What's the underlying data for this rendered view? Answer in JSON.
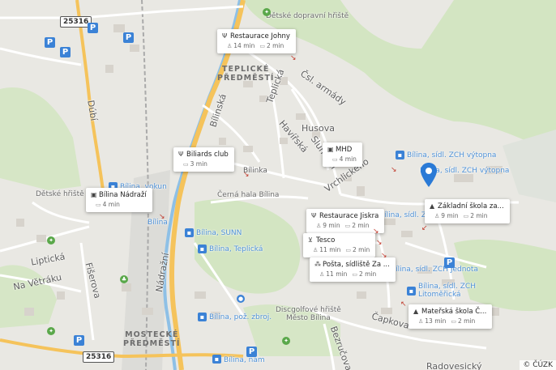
{
  "map": {
    "copyright": "© ČÚZK",
    "road_numbers": [
      "25316",
      "25316"
    ],
    "districts": [
      "TEPLICKÉ\nPŘEDMĚSTÍ",
      "MOSTECKÉ\nPŘEDMĚSTÍ"
    ],
    "streets": [
      "Dúbí",
      "Teplická",
      "Bílinská",
      "Čsl. armády",
      "Husova",
      "Havířská",
      "Sluneční",
      "Vrchlického",
      "Liptická",
      "Na Větráku",
      "Fišerova",
      "Nádražní",
      "Čapkova",
      "Bezručova",
      "Radovesický",
      "Bílinka"
    ],
    "places": [
      "Dětské dopravní hřiště",
      "Dětské hřiště Ph",
      "Černá hala Bílina",
      "Discgolfové hřiště\nMěsto Bílina"
    ],
    "stops": [
      "Bílina, sídl. ZCH výtopna",
      "Bílina, sídl. ZCH výtopna",
      "Bílina, vokun",
      "Bílina",
      "Bílina, SUNN",
      "Bílina, Teplická",
      "Bílina, sídl. ZCH",
      "Bílina, sídl. ZCH Jednota",
      "Bílina, sídl. ZCH\nLitoměřická",
      "Bílina, pož. zbroj.",
      "Bílina, nám"
    ],
    "colors": {
      "background": "#e9e8e3",
      "park": "#cfe2bf",
      "water": "#8ec0e6",
      "road_main": "#f5c35b",
      "transit_blue": "#3b82d6",
      "pin": "#2a7ad6"
    }
  },
  "pois": [
    {
      "title": "Restaurace Johny",
      "icon": "restaurant-icon",
      "walk": "14 min",
      "car": "2 min"
    },
    {
      "title": "Biliards club",
      "icon": "restaurant-icon",
      "car": "3 min"
    },
    {
      "title": "MHD",
      "icon": "bus-icon",
      "car": "4 min"
    },
    {
      "title": "Bílina Nádraží",
      "icon": "bus-icon",
      "car": "4 min"
    },
    {
      "title": "Základní škola za...",
      "icon": "school-icon",
      "walk": "9 min",
      "car": "2 min"
    },
    {
      "title": "Restaurace Jiskra",
      "icon": "restaurant-icon",
      "walk": "9 min",
      "car": "2 min"
    },
    {
      "title": "Tesco",
      "icon": "cart-icon",
      "walk": "11 min",
      "car": "2 min"
    },
    {
      "title": "Pošta, sídliště Za ...",
      "icon": "post-icon",
      "walk": "11 min",
      "car": "2 min"
    },
    {
      "title": "Mateřská škola Č...",
      "icon": "school-icon",
      "walk": "13 min",
      "car": "2 min"
    }
  ]
}
